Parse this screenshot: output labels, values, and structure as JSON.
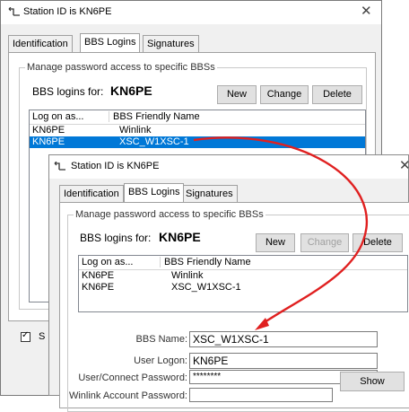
{
  "colors": {
    "arrow": "#e02020",
    "selection": "#0078d7"
  },
  "back": {
    "title": "Station ID is KN6PE",
    "tabs": [
      "Identification",
      "BBS Logins",
      "Signatures"
    ],
    "group_label": "Manage password access to specific BBSs",
    "logins_label": "BBS logins for:",
    "callsign": "KN6PE",
    "buttons": {
      "new": "New",
      "change": "Change",
      "delete": "Delete"
    },
    "columns": {
      "logon": "Log on as...",
      "friendly": "BBS Friendly Name"
    },
    "rows": [
      {
        "logon": "KN6PE",
        "friendly": "Winlink"
      },
      {
        "logon": "KN6PE",
        "friendly": "XSC_W1XSC-1"
      }
    ],
    "footer_text": "S"
  },
  "front": {
    "title": "Station ID is KN6PE",
    "tabs": [
      "Identification",
      "BBS Logins",
      "Signatures"
    ],
    "group_label": "Manage password access to specific BBSs",
    "logins_label": "BBS logins for:",
    "callsign": "KN6PE",
    "buttons": {
      "new": "New",
      "change": "Change",
      "delete": "Delete",
      "show": "Show"
    },
    "columns": {
      "logon": "Log on as...",
      "friendly": "BBS Friendly Name"
    },
    "rows": [
      {
        "logon": "KN6PE",
        "friendly": "Winlink"
      },
      {
        "logon": "KN6PE",
        "friendly": "XSC_W1XSC-1"
      }
    ],
    "form": {
      "bbs_name_label": "BBS Name:",
      "bbs_name_value": "XSC_W1XSC-1",
      "user_logon_label": "User Logon:",
      "user_logon_value": "KN6PE",
      "password_label": "User/Connect Password:",
      "password_value": "********",
      "winlink_label": "Winlink Account Password:"
    }
  }
}
